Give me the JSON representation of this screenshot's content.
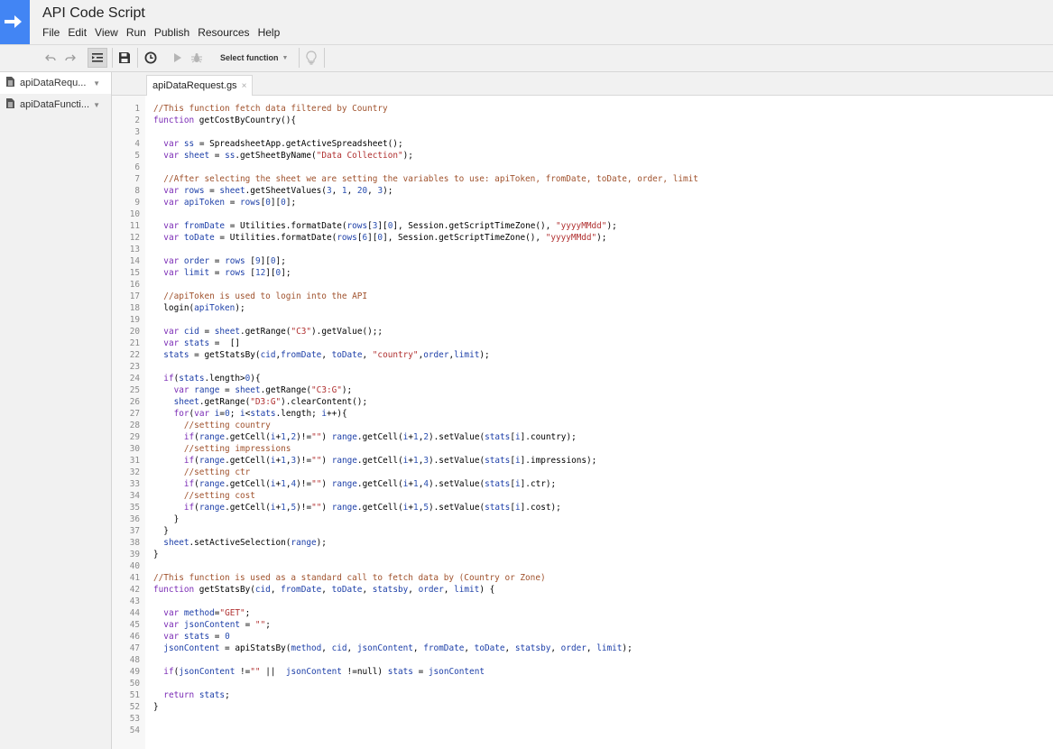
{
  "app": {
    "title": "API Code Script"
  },
  "menu": [
    "File",
    "Edit",
    "View",
    "Run",
    "Publish",
    "Resources",
    "Help"
  ],
  "toolbar": {
    "select_function_label": "Select function"
  },
  "sidebar": {
    "files": [
      {
        "label": "apiDataRequ...",
        "active": true
      },
      {
        "label": "apiDataFuncti...",
        "active": false
      }
    ]
  },
  "tabs": [
    {
      "label": "apiDataRequest.gs"
    }
  ],
  "code": {
    "lines": [
      "//This function fetch data filtered by Country",
      "function getCostByCountry(){",
      "",
      "  var ss = SpreadsheetApp.getActiveSpreadsheet();",
      "  var sheet = ss.getSheetByName(\"Data Collection\");",
      "",
      "  //After selecting the sheet we are setting the variables to use: apiToken, fromDate, toDate, order, limit",
      "  var rows = sheet.getSheetValues(3, 1, 20, 3);",
      "  var apiToken = rows[0][0];",
      "",
      "  var fromDate = Utilities.formatDate(rows[3][0], Session.getScriptTimeZone(), \"yyyyMMdd\");",
      "  var toDate = Utilities.formatDate(rows[6][0], Session.getScriptTimeZone(), \"yyyyMMdd\");",
      "",
      "  var order = rows [9][0];",
      "  var limit = rows [12][0];",
      "",
      "  //apiToken is used to login into the API",
      "  login(apiToken);",
      "",
      "  var cid = sheet.getRange(\"C3\").getValue();;",
      "  var stats =  []",
      "  stats = getStatsBy(cid,fromDate, toDate, \"country\",order,limit);",
      "",
      "  if(stats.length>0){",
      "    var range = sheet.getRange(\"C3:G\");",
      "    sheet.getRange(\"D3:G\").clearContent();",
      "    for(var i=0; i<stats.length; i++){",
      "      //setting country",
      "      if(range.getCell(i+1,2)!=\"\") range.getCell(i+1,2).setValue(stats[i].country);",
      "      //setting impressions",
      "      if(range.getCell(i+1,3)!=\"\") range.getCell(i+1,3).setValue(stats[i].impressions);",
      "      //setting ctr",
      "      if(range.getCell(i+1,4)!=\"\") range.getCell(i+1,4).setValue(stats[i].ctr);",
      "      //setting cost",
      "      if(range.getCell(i+1,5)!=\"\") range.getCell(i+1,5).setValue(stats[i].cost);",
      "    }",
      "  }",
      "  sheet.setActiveSelection(range);",
      "}",
      "",
      "//This function is used as a standard call to fetch data by (Country or Zone)",
      "function getStatsBy(cid, fromDate, toDate, statsby, order, limit) {",
      "",
      "  var method=\"GET\";",
      "  var jsonContent = \"\";",
      "  var stats = 0",
      "  jsonContent = apiStatsBy(method, cid, jsonContent, fromDate, toDate, statsby, order, limit);",
      "",
      "  if(jsonContent !=\"\" ||  jsonContent !=null) stats = jsonContent",
      "",
      "  return stats;",
      "}",
      "",
      ""
    ]
  }
}
